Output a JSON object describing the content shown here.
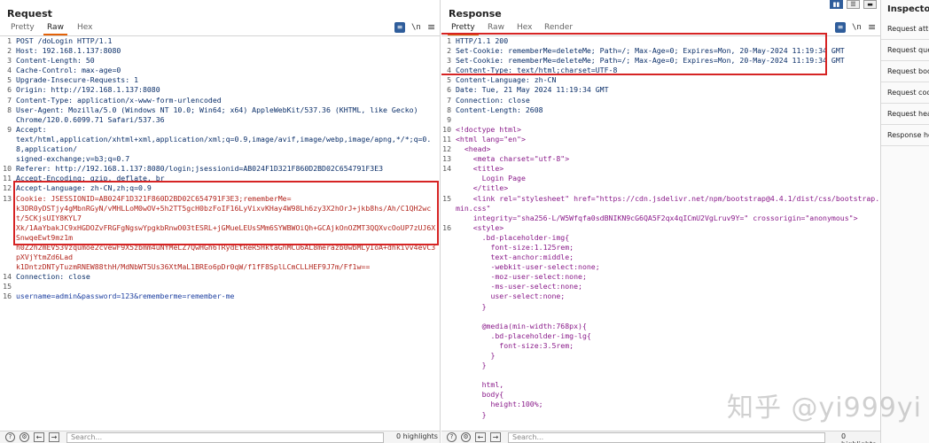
{
  "request": {
    "title": "Request",
    "tabs": [
      "Pretty",
      "Raw",
      "Hex"
    ],
    "active_tab": "Raw",
    "icon_label": "\\n",
    "lines": [
      {
        "n": "1",
        "t": "POST /doLogin HTTP/1.1"
      },
      {
        "n": "2",
        "t": "Host: 192.168.1.137:8080"
      },
      {
        "n": "3",
        "t": "Content-Length: 50"
      },
      {
        "n": "4",
        "t": "Cache-Control: max-age=0"
      },
      {
        "n": "5",
        "t": "Upgrade-Insecure-Requests: 1"
      },
      {
        "n": "6",
        "t": "Origin: http://192.168.1.137:8080"
      },
      {
        "n": "7",
        "t": "Content-Type: application/x-www-form-urlencoded"
      },
      {
        "n": "8",
        "t": "User-Agent: Mozilla/5.0 (Windows NT 10.0; Win64; x64) AppleWebKit/537.36 (KHTML, like Gecko)\nChrome/120.0.6099.71 Safari/537.36"
      },
      {
        "n": "9",
        "t": "Accept:\ntext/html,application/xhtml+xml,application/xml;q=0.9,image/avif,image/webp,image/apng,*/*;q=0.8,application/\nsigned-exchange;v=b3;q=0.7"
      },
      {
        "n": "10",
        "t": "Referer: http://192.168.1.137:8080/login;jsessionid=AB024F1D321F860D2BD02C654791F3E3"
      },
      {
        "n": "11",
        "t": "Accept-Encoding: gzip, deflate, br"
      },
      {
        "n": "12",
        "t": "Accept-Language: zh-CN,zh;q=0.9"
      },
      {
        "n": "13",
        "t": "Cookie: JSESSIONID=AB024F1D321F860D2BD02C654791F3E3;rememberMe=\nk3DR0yDSTjy4gMbnRGyN/vMHLLoM0wOV+5h2TT5gcH0bzFoIF16LyVixvKHay4W98Lh6zy3X2hOrJ+jkb8hs/Ah/C1QH2wct/5CKjsUIY8KYL7\nXk/1AaYbakJC9xHGDOZvFRGFgNgswYpgkbRnwO03tESRL+jGMueLEUsSMm6SYWBWOiQh+GCAjkOnOZMT3QQXvcOoUP7zUJ6XSnwqeEwt9mz1m\nh0Z2h2mEV53Vzqumoe2cvewF9X5zbmm4uNYMeLZ7QwHGh6TRydEtReR5HktaGhMCu6AL8merazb0wbMLyIoA+dhkivv4evC3pXVjYtmZd6Lad\nk1DntzDNTyTuzmRNEW88thH/MdNbWT5Us36XtMaL1BREo6pDr0qW/f1fF8SplLCmCLLHEF9J7m/Ff1w=="
      },
      {
        "n": "14",
        "t": "Connection: close"
      },
      {
        "n": "15",
        "t": ""
      },
      {
        "n": "16",
        "t": "username=admin&password=123&rememberme=remember-me"
      }
    ],
    "search_placeholder": "Search...",
    "highlights": "0 highlights"
  },
  "response": {
    "title": "Response",
    "tabs": [
      "Pretty",
      "Raw",
      "Hex",
      "Render"
    ],
    "active_tab": "Pretty",
    "icon_label": "\\n",
    "lines": [
      {
        "n": "1",
        "t": "HTTP/1.1 200"
      },
      {
        "n": "2",
        "t": "Set-Cookie: rememberMe=deleteMe; Path=/; Max-Age=0; Expires=Mon, 20-May-2024 11:19:34 GMT"
      },
      {
        "n": "3",
        "t": "Set-Cookie: rememberMe=deleteMe; Path=/; Max-Age=0; Expires=Mon, 20-May-2024 11:19:34 GMT"
      },
      {
        "n": "4",
        "t": "Content-Type: text/html;charset=UTF-8"
      },
      {
        "n": "5",
        "t": "Content-Language: zh-CN"
      },
      {
        "n": "6",
        "t": "Date: Tue, 21 May 2024 11:19:34 GMT"
      },
      {
        "n": "7",
        "t": "Connection: close"
      },
      {
        "n": "8",
        "t": "Content-Length: 2608"
      },
      {
        "n": "9",
        "t": ""
      },
      {
        "n": "10",
        "t": "<!doctype html>"
      },
      {
        "n": "11",
        "t": "<html lang=\"en\">"
      },
      {
        "n": "12",
        "t": "  <head>"
      },
      {
        "n": "13",
        "t": "    <meta charset=\"utf-8\">"
      },
      {
        "n": "14",
        "t": "    <title>\n      Login Page\n    </title>"
      },
      {
        "n": "15",
        "t": "    <link rel=\"stylesheet\" href=\"https://cdn.jsdelivr.net/npm/bootstrap@4.4.1/dist/css/bootstrap.min.css\"\n    integrity=\"sha256-L/W5Wfqfa0sdBNIKN9cG6QA5F2qx4qICmU2VgLruv9Y=\" crossorigin=\"anonymous\">"
      },
      {
        "n": "16",
        "t": "    <style>\n      .bd-placeholder-img{\n        font-size:1.125rem;\n        text-anchor:middle;\n        -webkit-user-select:none;\n        -moz-user-select:none;\n        -ms-user-select:none;\n        user-select:none;\n      }\n\n      @media(min-width:768px){\n        .bd-placeholder-img-lg{\n          font-size:3.5rem;\n        }\n      }\n\n      html,\n      body{\n        height:100%;\n      }\n\n      body{"
      }
    ],
    "search_placeholder": "Search...",
    "highlights": "0 highlights"
  },
  "inspector": {
    "title": "Inspector",
    "items": [
      "Request attributes",
      "Request query parameters",
      "Request body parameters",
      "Request cookies",
      "Request headers",
      "Response headers"
    ]
  },
  "watermark": "知乎 @yi999yi",
  "colors": {
    "highlight_box": "#d62424",
    "active_tab_underline": "#e36209",
    "accent": "#2f5d9b"
  }
}
